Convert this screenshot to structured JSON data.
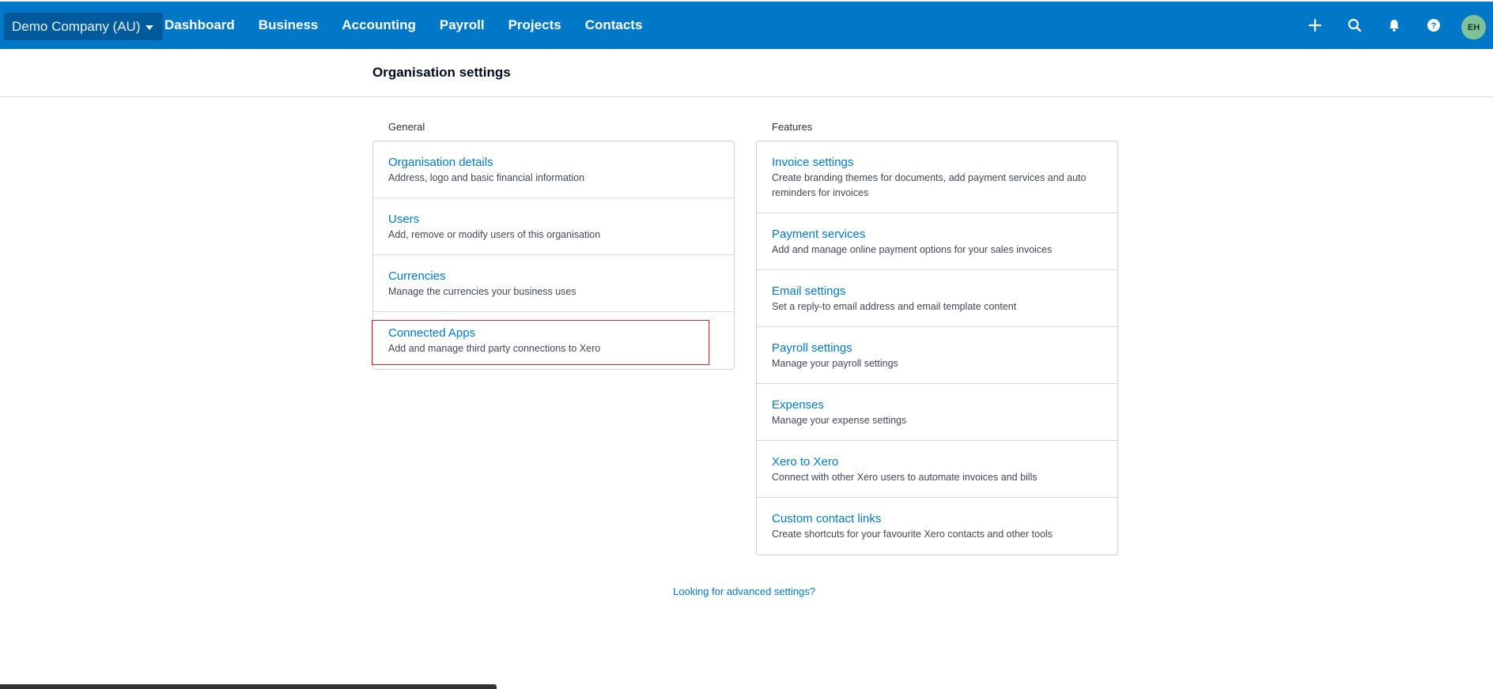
{
  "topbar": {
    "org_name": "Demo Company (AU)",
    "nav": [
      "Dashboard",
      "Business",
      "Accounting",
      "Payroll",
      "Projects",
      "Contacts"
    ],
    "icons": [
      "plus-icon",
      "search-icon",
      "bell-icon",
      "help-icon"
    ],
    "avatar_initials": "EH",
    "colors": {
      "bar": "#0078c8",
      "org_switcher": "#005a9c",
      "avatar": "#80c19d"
    }
  },
  "page": {
    "title": "Organisation settings"
  },
  "general": {
    "label": "General",
    "items": [
      {
        "title": "Organisation details",
        "desc": "Address, logo and basic financial information"
      },
      {
        "title": "Users",
        "desc": "Add, remove or modify users of this organisation"
      },
      {
        "title": "Currencies",
        "desc": "Manage the currencies your business uses"
      },
      {
        "title": "Connected Apps",
        "desc": "Add and manage third party connections to Xero"
      }
    ]
  },
  "features": {
    "label": "Features",
    "items": [
      {
        "title": "Invoice settings",
        "desc": "Create branding themes for documents, add payment services and auto reminders for invoices"
      },
      {
        "title": "Payment services",
        "desc": "Add and manage online payment options for your sales invoices"
      },
      {
        "title": "Email settings",
        "desc": "Set a reply-to email address and email template content"
      },
      {
        "title": "Payroll settings",
        "desc": "Manage your payroll settings"
      },
      {
        "title": "Expenses",
        "desc": "Manage your expense settings"
      },
      {
        "title": "Xero to Xero",
        "desc": "Connect with other Xero users to automate invoices and bills"
      },
      {
        "title": "Custom contact links",
        "desc": "Create shortcuts for your favourite Xero contacts and other tools"
      }
    ]
  },
  "advanced_link": "Looking for advanced settings?",
  "accent_color": "#0078c8",
  "highlight_color": "#e02020"
}
